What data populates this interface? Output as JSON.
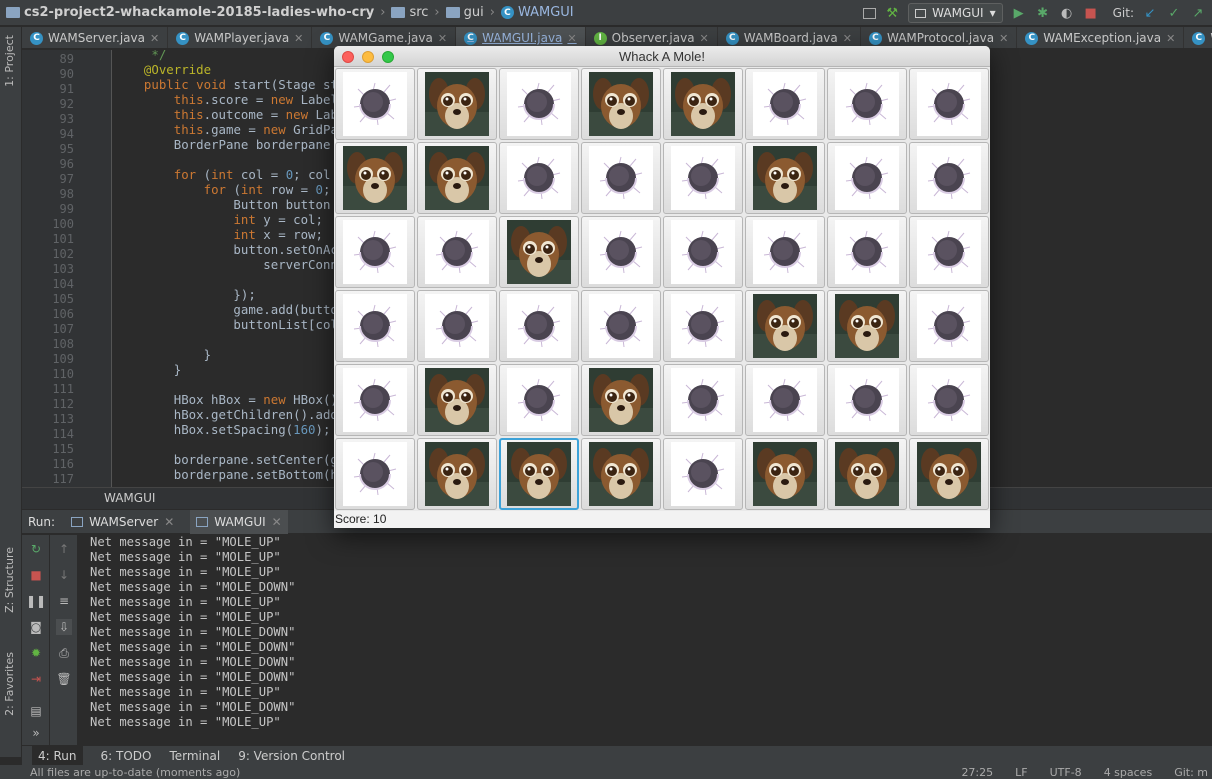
{
  "breadcrumb": {
    "project": "cs2-project2-whackamole-20185-ladies-who-cry",
    "src": "src",
    "gui": "gui",
    "file": "WAMGUI"
  },
  "toolbar": {
    "run_config": "WAMGUI",
    "git_label": "Git:"
  },
  "editor_tabs": [
    {
      "label": "WAMServer.java",
      "kind": "class"
    },
    {
      "label": "WAMPlayer.java",
      "kind": "class"
    },
    {
      "label": "WAMGame.java",
      "kind": "class"
    },
    {
      "label": "WAMGUI.java",
      "kind": "class",
      "active": true
    },
    {
      "label": "Observer.java",
      "kind": "interface"
    },
    {
      "label": "WAMBoard.java",
      "kind": "class"
    },
    {
      "label": "WAMProtocol.java",
      "kind": "class"
    },
    {
      "label": "WAMException.java",
      "kind": "class"
    },
    {
      "label": "WAMNetworkClien",
      "kind": "class"
    }
  ],
  "side_labels": {
    "project": "1: Project",
    "structure": "Z: Structure",
    "favorites": "2: Favorites"
  },
  "code": [
    {
      "n": "",
      "t": "   */"
    },
    {
      "n": "89",
      "t": "  @Override"
    },
    {
      "n": "90",
      "t": "  public void start(Stage stage"
    },
    {
      "n": "91",
      "t": "      this.score = new Label( s"
    },
    {
      "n": "92",
      "t": "      this.outcome = new Label("
    },
    {
      "n": "93",
      "t": "      this.game = new GridPane("
    },
    {
      "n": "94",
      "t": "      BorderPane borderpane = ne"
    },
    {
      "n": "95",
      "t": ""
    },
    {
      "n": "96",
      "t": "      for (int col = 0; col < b"
    },
    {
      "n": "97",
      "t": "          for (int row = 0; row"
    },
    {
      "n": "98",
      "t": "              Button button = ne"
    },
    {
      "n": "99",
      "t": "              int y = col;"
    },
    {
      "n": "100",
      "t": "              int x = row;"
    },
    {
      "n": "101",
      "t": "              button.setOnAction"
    },
    {
      "n": "102",
      "t": "                  serverConn.se"
    },
    {
      "n": "103",
      "t": ""
    },
    {
      "n": "104",
      "t": "              });"
    },
    {
      "n": "105",
      "t": "              game.add(button,"
    },
    {
      "n": "106",
      "t": "              buttonList[col][r"
    },
    {
      "n": "107",
      "t": ""
    },
    {
      "n": "108",
      "t": "          }"
    },
    {
      "n": "109",
      "t": "      }"
    },
    {
      "n": "110",
      "t": ""
    },
    {
      "n": "111",
      "t": "      HBox hBox = new HBox();"
    },
    {
      "n": "112",
      "t": "      hBox.getChildren().addAll"
    },
    {
      "n": "113",
      "t": "      hBox.setSpacing(160);"
    },
    {
      "n": "114",
      "t": ""
    },
    {
      "n": "115",
      "t": "      borderpane.setCenter(game"
    },
    {
      "n": "116",
      "t": "      borderpane.setBottom(hBox"
    }
  ],
  "line_numbers": [
    "",
    "89",
    "90",
    "91",
    "92",
    "93",
    "94",
    "95",
    "96",
    "97",
    "98",
    "99",
    "100",
    "101",
    "102",
    "103",
    "104",
    "105",
    "106",
    "107",
    "108",
    "109",
    "110",
    "111",
    "112",
    "113",
    "114",
    "115",
    "116",
    "117"
  ],
  "editor_footer": "WAMGUI",
  "run": {
    "label": "Run:",
    "tabs": [
      "WAMServer",
      "WAMGUI"
    ]
  },
  "console": [
    "Net message in = \"MOLE_UP\"",
    "Net message in = \"MOLE_UP\"",
    "Net message in = \"MOLE_UP\"",
    "Net message in = \"MOLE_DOWN\"",
    "Net message in = \"MOLE_UP\"",
    "Net message in = \"MOLE_UP\"",
    "Net message in = \"MOLE_DOWN\"",
    "Net message in = \"MOLE_DOWN\"",
    "Net message in = \"MOLE_DOWN\"",
    "Net message in = \"MOLE_DOWN\"",
    "Net message in = \"MOLE_UP\"",
    "Net message in = \"MOLE_DOWN\"",
    "Net message in = \"MOLE_UP\""
  ],
  "bottom_tabs": [
    {
      "label": "4: Run"
    },
    {
      "label": "6: TODO"
    },
    {
      "label": "Terminal"
    },
    {
      "label": "9: Version Control"
    }
  ],
  "status": {
    "message": "All files are up-to-date (moments ago)",
    "position": "27:25",
    "line_sep": "LF",
    "encoding": "UTF-8",
    "indent": "4 spaces",
    "git": "Git: m"
  },
  "game": {
    "title": "Whack A Mole!",
    "score_text": "Score: 10",
    "board": [
      [
        0,
        1,
        0,
        1,
        1,
        0,
        0,
        0
      ],
      [
        1,
        1,
        0,
        0,
        0,
        1,
        0,
        0
      ],
      [
        0,
        0,
        1,
        0,
        0,
        0,
        0,
        0
      ],
      [
        0,
        0,
        0,
        0,
        0,
        1,
        1,
        0
      ],
      [
        0,
        1,
        0,
        1,
        0,
        0,
        0,
        0
      ],
      [
        0,
        1,
        1,
        1,
        0,
        1,
        1,
        1
      ]
    ],
    "focused_cell": [
      5,
      2
    ]
  }
}
